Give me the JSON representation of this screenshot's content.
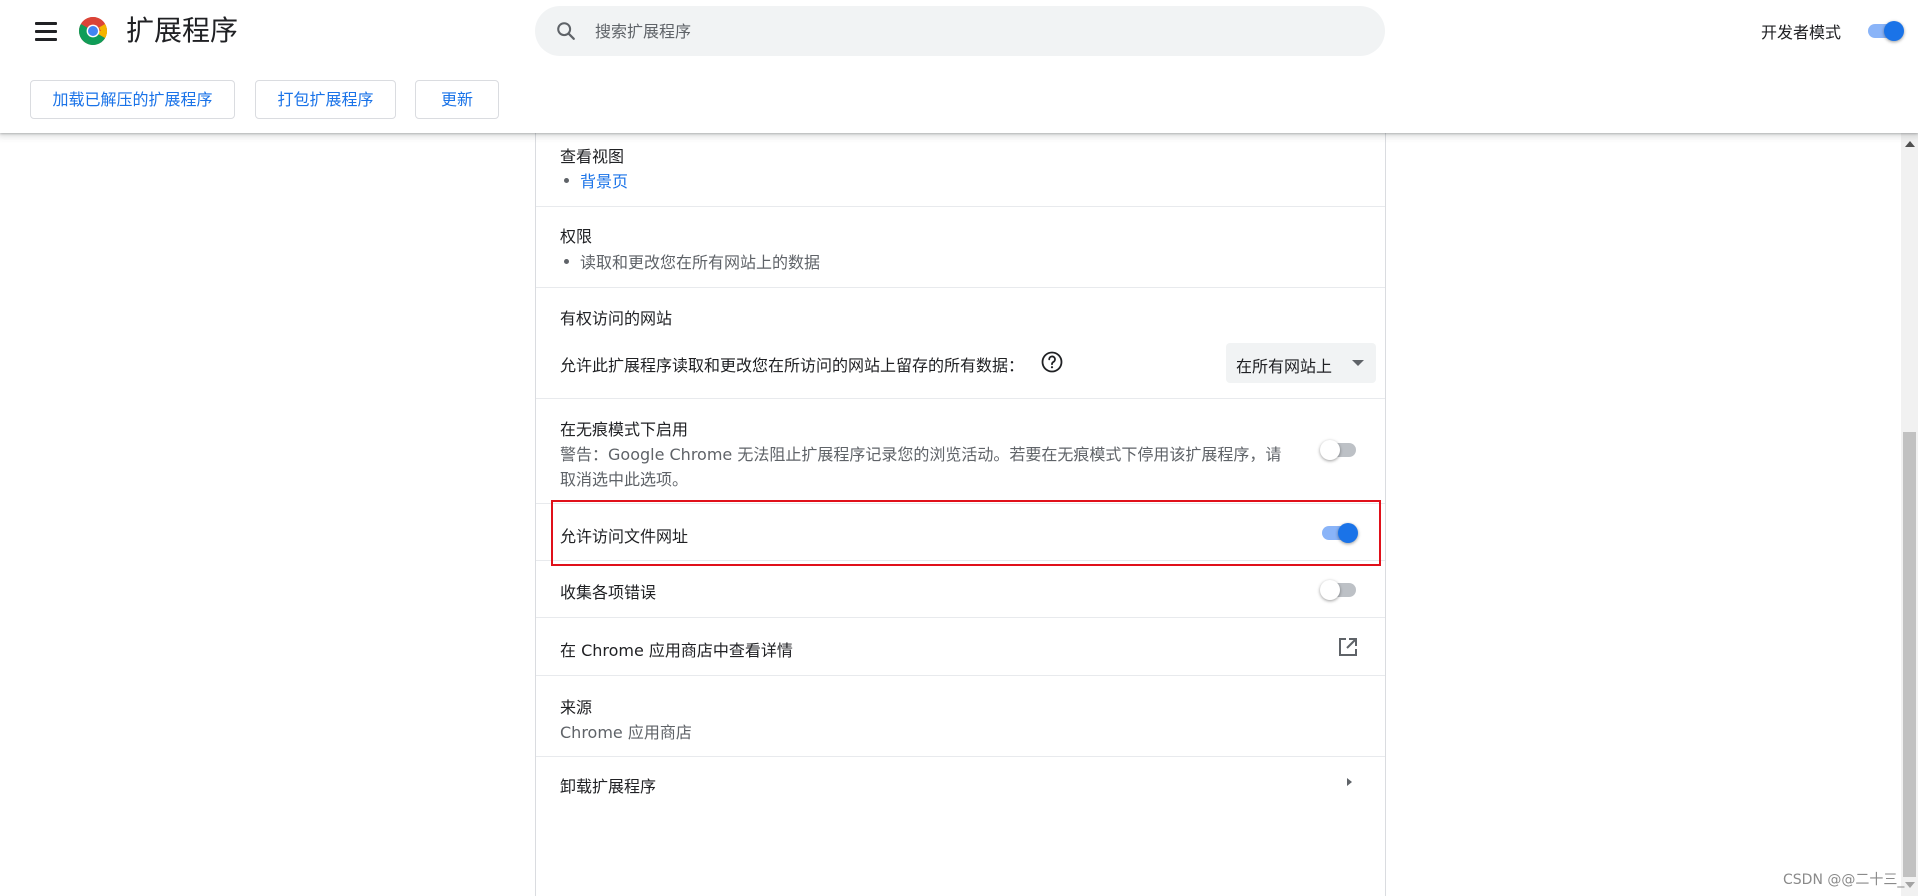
{
  "header": {
    "title": "扩展程序",
    "search_placeholder": "搜索扩展程序",
    "dev_mode_label": "开发者模式",
    "dev_mode_on": true
  },
  "toolbar": {
    "load_unpacked": "加载已解压的扩展程序",
    "pack": "打包扩展程序",
    "update": "更新"
  },
  "details": {
    "inspect_views": {
      "title": "查看视图",
      "items": [
        "背景页"
      ]
    },
    "permissions": {
      "title": "权限",
      "items": [
        "读取和更改您在所有网站上的数据"
      ]
    },
    "site_access": {
      "title": "有权访问的网站",
      "description": "允许此扩展程序读取和更改您在所访问的网站上留存的所有数据：",
      "selected": "在所有网站上"
    },
    "incognito": {
      "title": "在无痕模式下启用",
      "warning_line1": "警告：Google Chrome 无法阻止扩展程序记录您的浏览活动。若要在无痕模式下停用该扩展程序，请",
      "warning_line2": "取消选中此选项。",
      "enabled": false
    },
    "file_access": {
      "title": "允许访问文件网址",
      "enabled": true
    },
    "collect_errors": {
      "title": "收集各项错误",
      "enabled": false
    },
    "webstore": {
      "title": "在 Chrome 应用商店中查看详情"
    },
    "source": {
      "title": "来源",
      "value": "Chrome 应用商店"
    },
    "remove": {
      "title": "卸载扩展程序"
    }
  },
  "watermark": "CSDN @@二十三_",
  "colors": {
    "accent": "#1a73e8",
    "highlight_border": "#e0101a"
  }
}
